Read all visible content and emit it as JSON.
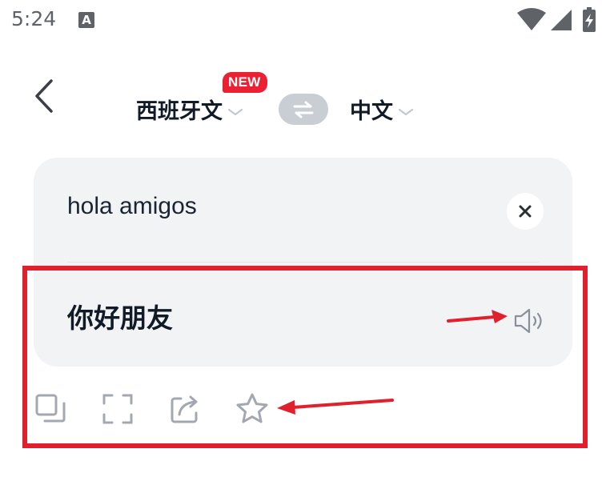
{
  "status_bar": {
    "time": "5:24",
    "notification_icon": "A",
    "icons": [
      "wifi-icon",
      "signal-icon",
      "battery-charging-icon"
    ]
  },
  "header": {
    "back_icon": "chevron-left-icon",
    "source_language": "西班牙文",
    "target_language": "中文",
    "new_badge": "NEW",
    "swap_icon": "swap-arrows-icon"
  },
  "input": {
    "text": "hola amigos",
    "clear_icon": "close-icon"
  },
  "result": {
    "text": "你好朋友",
    "speaker_icon": "speaker-icon"
  },
  "actions": [
    "copy-icon",
    "fullscreen-icon",
    "share-icon",
    "star-icon"
  ],
  "annotation": {
    "highlight_color": "#e0202c"
  },
  "colors": {
    "card_background": "#f2f3f5",
    "badge": "#ec2033",
    "swap_button": "#c9cdd4",
    "icon_gray": "#8a9099"
  }
}
